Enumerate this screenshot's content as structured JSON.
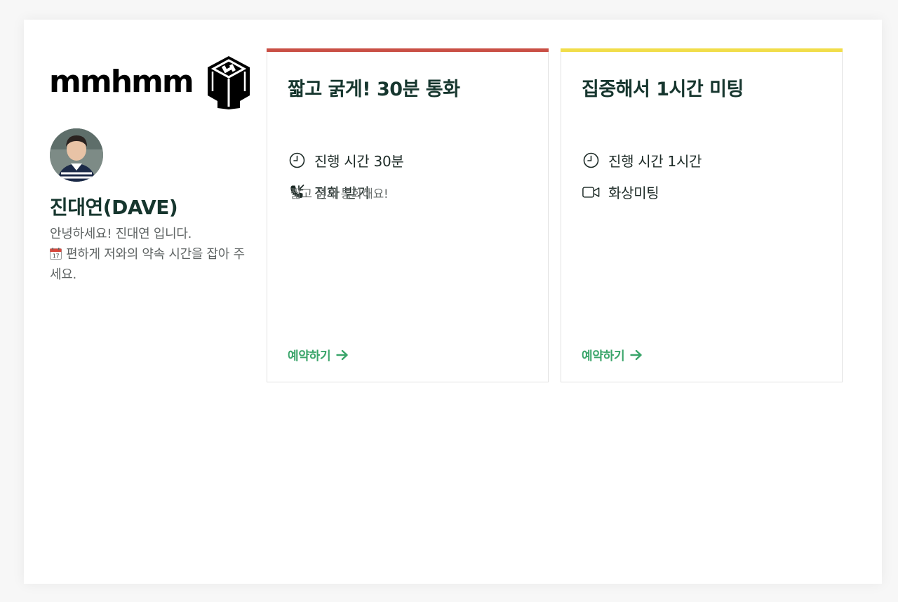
{
  "brand": {
    "name": "mmhmm"
  },
  "profile": {
    "name": "진대연(DAVE)",
    "bio_line1": "안녕하세요! 진대연 입니다.",
    "bio_line2": "편하게 저와의 약속 시간을 잡아 주세요.",
    "calendar_icon": "calendar-icon"
  },
  "cards": [
    {
      "title": "짧고 굵게! 30분 통화",
      "accent_color": "#c94f45",
      "duration": "진행 시간 30분",
      "duration_icon": "clock-icon",
      "type": "전화 받기",
      "type_icon": "phone-incoming-icon",
      "description": "짧고 굵게 통화해요!",
      "book_label": "예약하기"
    },
    {
      "title": "집중해서 1시간 미팅",
      "accent_color": "#f1dd4a",
      "duration": "진행 시간 1시간",
      "duration_icon": "clock-icon",
      "type": "화상미팅",
      "type_icon": "video-camera-icon",
      "description": "",
      "book_label": "예약하기"
    }
  ],
  "colors": {
    "title": "#16362e",
    "link": "#3aa56a",
    "muted_text": "#5f6464"
  }
}
